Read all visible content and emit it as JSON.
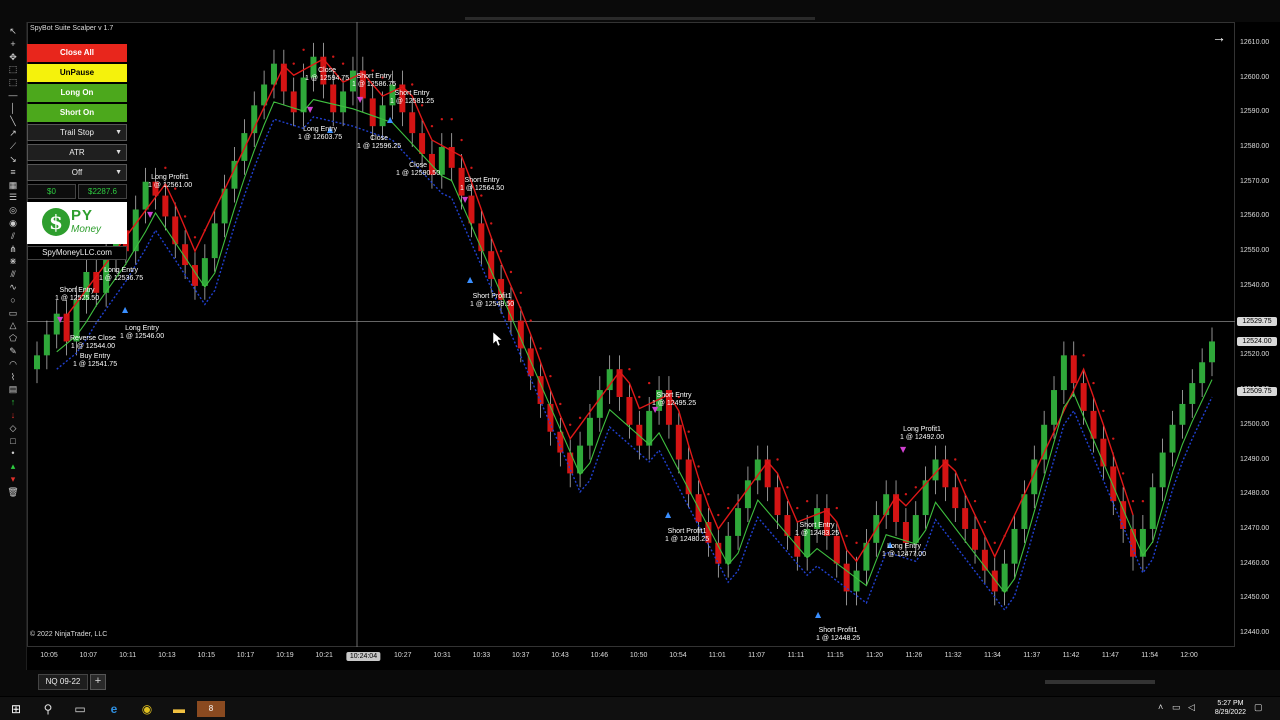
{
  "window": {
    "title": "SpyBot Suite Scalper v 1.7",
    "copyright": "© 2022 NinjaTrader, LLC"
  },
  "panel": {
    "buttons": [
      {
        "label": "Close All",
        "color": "#e8261c",
        "text_color": "#ffffff"
      },
      {
        "label": "UnPause",
        "color": "#f5f20c",
        "text_color": "#000000"
      },
      {
        "label": "Long On",
        "color": "#4ca81c",
        "text_color": "#ffffff"
      },
      {
        "label": "Short On",
        "color": "#4ca81c",
        "text_color": "#ffffff"
      }
    ],
    "selects": [
      {
        "label": "Trail Stop"
      },
      {
        "label": "ATR"
      },
      {
        "label": "Off"
      }
    ],
    "pnl": {
      "realized": "$0",
      "unrealized": "$2287.6"
    },
    "logo": {
      "text_top": "PY",
      "text_bottom": "Money",
      "site": "SpyMoneyLLC.com"
    }
  },
  "toolbar_icons": [
    "pointer-icon",
    "crosshair-icon",
    "hand-icon",
    "dotted-box-icon",
    "dotted-box-icon",
    "horizontal-line-icon",
    "vertical-line-icon",
    "line-icon",
    "ray-icon",
    "extended-line-icon",
    "arrow-line-icon",
    "list-icon",
    "ruler-icon",
    "fib-icon",
    "fib-circle-icon",
    "fib-spiral-icon",
    "trend-channel-icon",
    "andrews-icon",
    "gann-icon",
    "regression-icon",
    "wave-icon",
    "circle-icon",
    "rectangle-icon",
    "triangle-icon",
    "polygon-icon",
    "brush-icon",
    "arc-icon",
    "path-icon",
    "region-icon",
    "arrow-up-icon",
    "arrow-down-icon",
    "diamond-icon",
    "square-icon",
    "dot-icon",
    "triangle-up-icon",
    "triangle-down-icon",
    "trash-icon"
  ],
  "price_axis": {
    "ticks": [
      "12610.00",
      "12600.00",
      "12590.00",
      "12580.00",
      "12570.00",
      "12560.00",
      "12550.00",
      "12540.00",
      "12530.00",
      "12520.00",
      "12510.00",
      "12500.00",
      "12490.00",
      "12480.00",
      "12470.00",
      "12460.00",
      "12450.00",
      "12440.00"
    ],
    "tags": [
      "12529.75",
      "12524.00",
      "12509.75"
    ]
  },
  "time_axis": {
    "ticks": [
      "10:05",
      "10:07",
      "10:11",
      "10:13",
      "10:15",
      "10:17",
      "10:19",
      "10:21",
      "10:24:04",
      "10:27",
      "10:31",
      "10:33",
      "10:37",
      "10:43",
      "10:46",
      "10:50",
      "10:54",
      "11:01",
      "11:07",
      "11:11",
      "11:15",
      "11:20",
      "11:26",
      "11:32",
      "11:34",
      "11:37",
      "11:42",
      "11:47",
      "11:54",
      "12:00"
    ],
    "current": "10:24:04"
  },
  "chart_data": {
    "type": "candlestick",
    "instrument": "NQ 09-22",
    "ylim": [
      12436,
      12616
    ],
    "y_unit": "price",
    "closes": [
      12520,
      12526,
      12532,
      12524,
      12536,
      12544,
      12538,
      12548,
      12556,
      12550,
      12562,
      12570,
      12566,
      12560,
      12552,
      12546,
      12540,
      12548,
      12558,
      12568,
      12576,
      12584,
      12592,
      12598,
      12604,
      12596,
      12590,
      12600,
      12606,
      12598,
      12590,
      12596,
      12602,
      12594,
      12586,
      12592,
      12598,
      12590,
      12584,
      12578,
      12572,
      12580,
      12574,
      12566,
      12558,
      12550,
      12542,
      12536,
      12530,
      12522,
      12514,
      12506,
      12498,
      12492,
      12486,
      12494,
      12502,
      12510,
      12516,
      12508,
      12500,
      12494,
      12504,
      12510,
      12500,
      12490,
      12480,
      12472,
      12466,
      12460,
      12468,
      12476,
      12484,
      12490,
      12482,
      12474,
      12468,
      12462,
      12470,
      12476,
      12468,
      12460,
      12452,
      12458,
      12466,
      12474,
      12480,
      12472,
      12466,
      12474,
      12484,
      12490,
      12482,
      12476,
      12470,
      12464,
      12458,
      12452,
      12460,
      12470,
      12480,
      12490,
      12500,
      12510,
      12520,
      12512,
      12504,
      12496,
      12488,
      12478,
      12470,
      12462,
      12470,
      12482,
      12492,
      12500,
      12506,
      12512,
      12518,
      12524
    ]
  },
  "annotations": [
    {
      "text": "Close\n1 @ 12594.75"
    },
    {
      "text": "Short Entry\n1 @ 12586.75"
    },
    {
      "text": "Short Entry\n1 @ 12581.25"
    },
    {
      "text": "Long Entry\n1 @ 12603.75"
    },
    {
      "text": "Close\n1 @ 12596.25"
    },
    {
      "text": "Close\n1 @ 12590.50"
    },
    {
      "text": "Short Entry\n1 @ 12564.50"
    },
    {
      "text": "Long Profit1\n1 @ 12561.00"
    },
    {
      "text": "Short Profit1\n1 @ 12549.50"
    },
    {
      "text": "Short Entry\n1 @ 12525.50"
    },
    {
      "text": "Long Entry\n1 @ 12536.75"
    },
    {
      "text": "Long Entry\n1 @ 12546.00"
    },
    {
      "text": "Reverse Close\n1 @ 12544.00"
    },
    {
      "text": "Buy Entry\n1 @ 12541.75"
    },
    {
      "text": "Short Entry\n1 @ 12495.25"
    },
    {
      "text": "Long Profit1\n1 @ 12492.00"
    },
    {
      "text": "Short Profit1\n1 @ 12480.25"
    },
    {
      "text": "Short Entry\n1 @ 12483.25"
    },
    {
      "text": "Long Entry\n1 @ 12477.00"
    },
    {
      "text": "Short Profit1\n1 @ 12448.25"
    }
  ],
  "tabs": {
    "instrument": "NQ 09-22",
    "add": "+"
  },
  "taskbar": {
    "time": "5:27 PM",
    "date": "8/29/2022",
    "badge": "8"
  }
}
